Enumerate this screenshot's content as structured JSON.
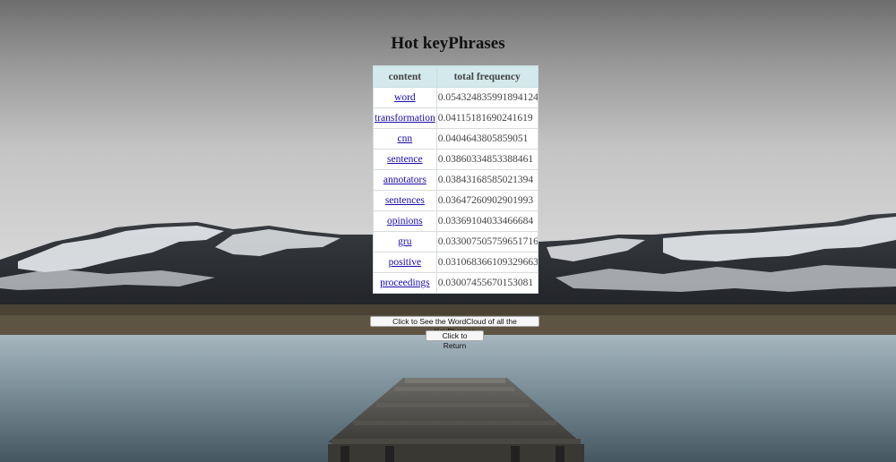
{
  "page": {
    "title": "Hot keyPhrases"
  },
  "table": {
    "headers": [
      "content",
      "total frequency"
    ],
    "rows": [
      {
        "content": "word",
        "frequency": "0.054324835991894124"
      },
      {
        "content": "transformation",
        "frequency": "0.04115181690241619"
      },
      {
        "content": "cnn",
        "frequency": "0.0404643805859051"
      },
      {
        "content": "sentence",
        "frequency": "0.03860334853388461"
      },
      {
        "content": "annotators",
        "frequency": "0.03843168585021394"
      },
      {
        "content": "sentences",
        "frequency": "0.03647260902901993"
      },
      {
        "content": "opinions",
        "frequency": "0.03369104033466684"
      },
      {
        "content": "gru",
        "frequency": "0.033007505759651716"
      },
      {
        "content": "positive",
        "frequency": "0.031068366109329663"
      },
      {
        "content": "proceedings",
        "frequency": "0.03007455670153081"
      }
    ]
  },
  "buttons": {
    "wordcloud_label": "Click to See the WordCloud of all the KeyPhrases",
    "return_label": "Click to Return"
  },
  "colors": {
    "header_bg": "#d3e9ec",
    "link": "#1a0dab"
  }
}
